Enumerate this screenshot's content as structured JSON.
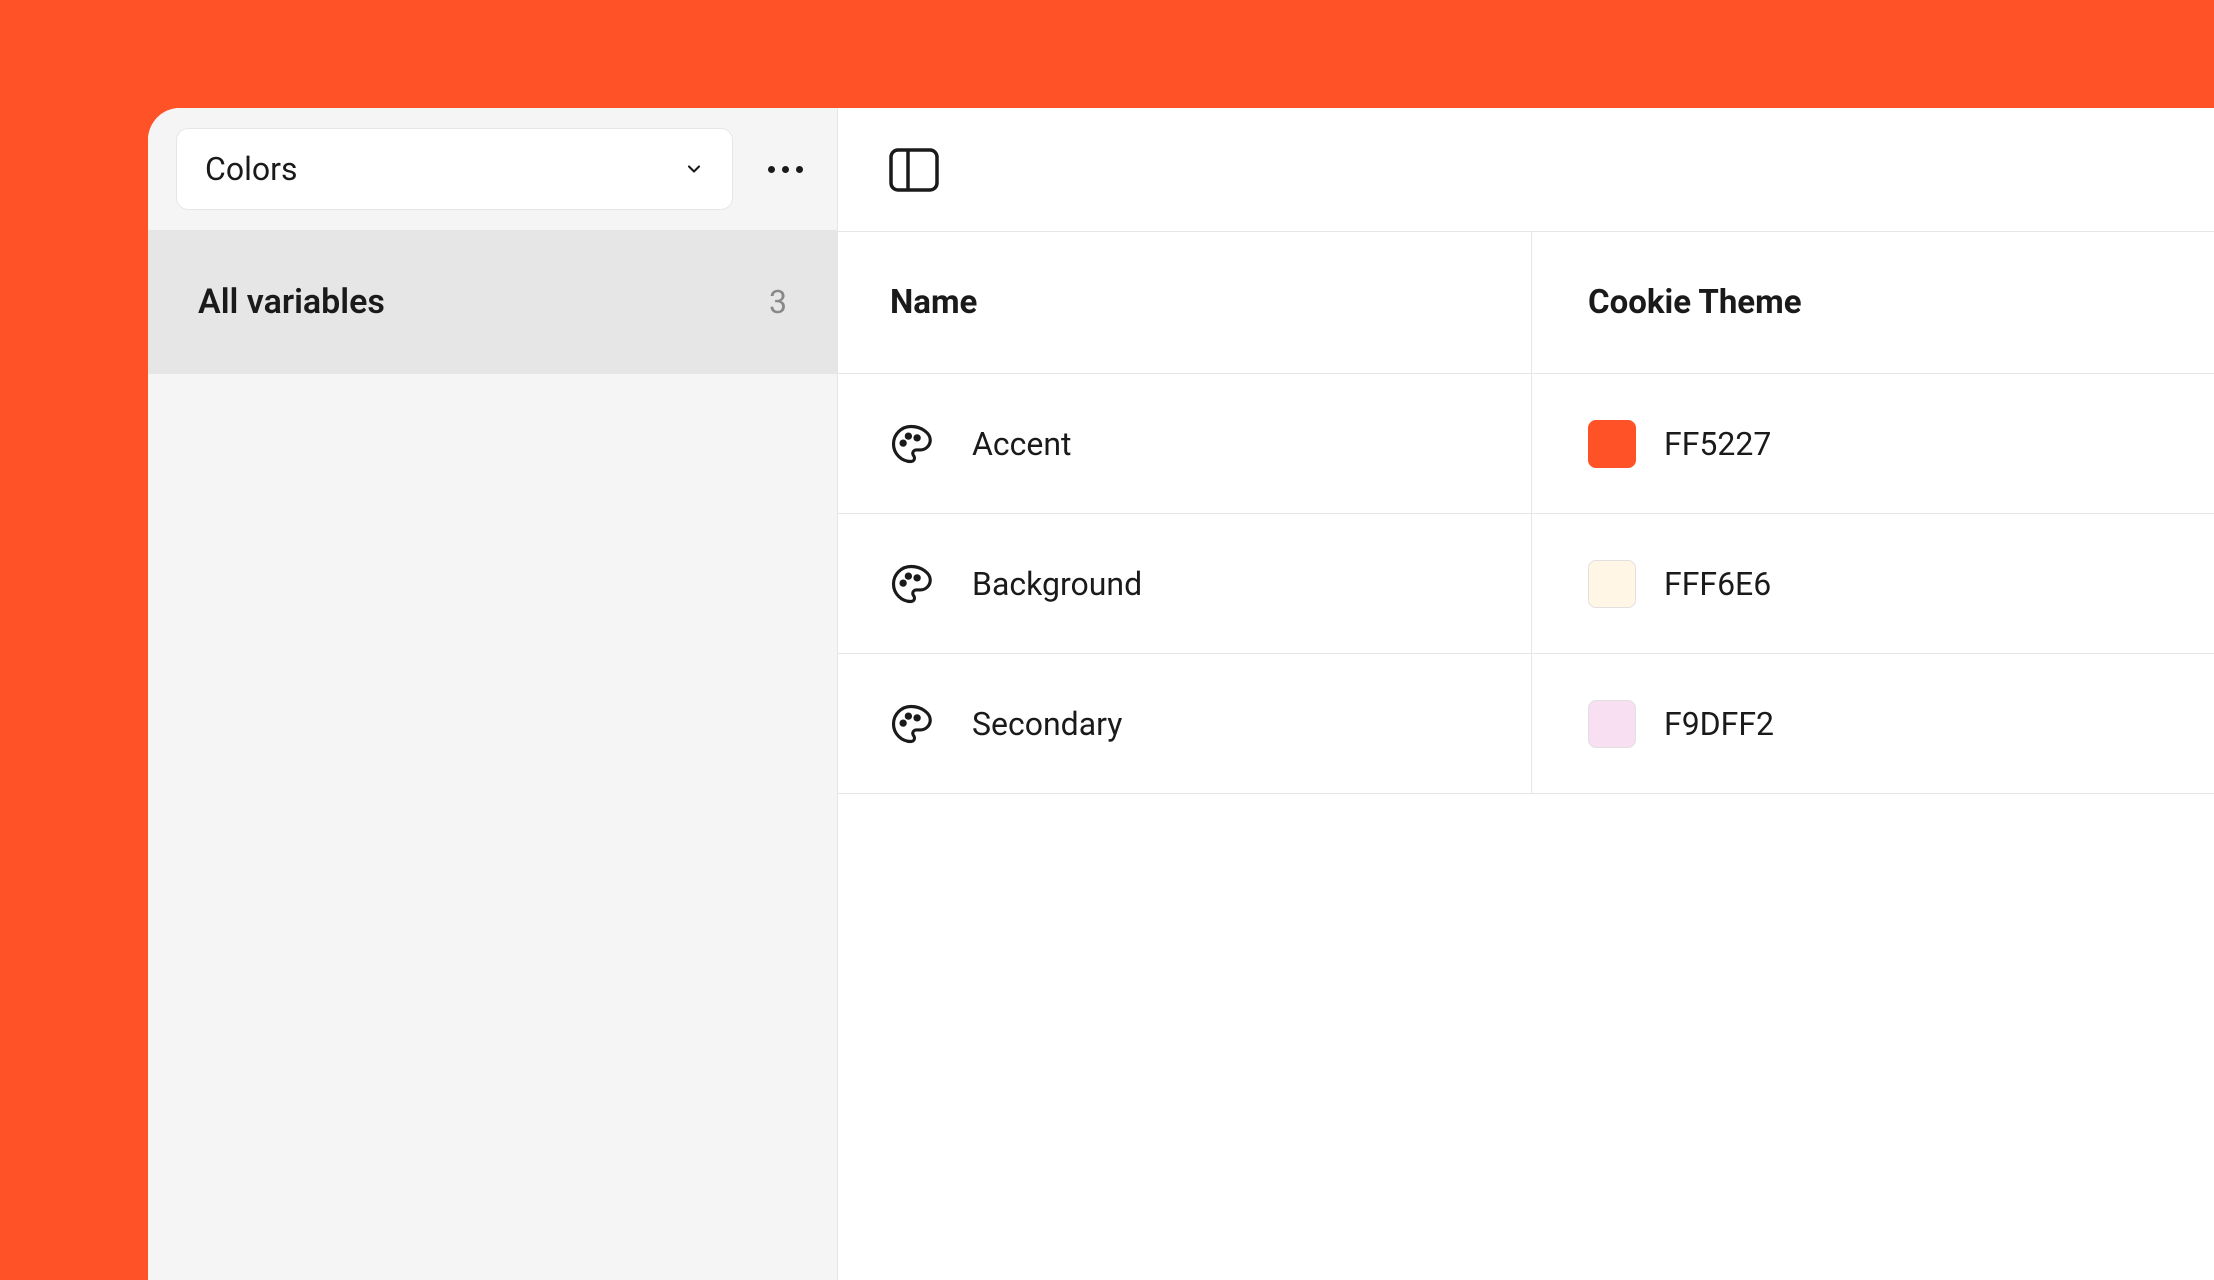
{
  "sidebar": {
    "collection_name": "Colors",
    "all_variables_label": "All variables",
    "variable_count": "3"
  },
  "table": {
    "headers": {
      "name": "Name",
      "mode": "Cookie Theme"
    },
    "rows": [
      {
        "name": "Accent",
        "hex": "FF5227",
        "swatch": "#FF5227",
        "bordered": false
      },
      {
        "name": "Background",
        "hex": "FFF6E6",
        "swatch": "#FFF6E6",
        "bordered": true
      },
      {
        "name": "Secondary",
        "hex": "F9DFF2",
        "swatch": "#F9DFF2",
        "bordered": true
      }
    ]
  }
}
